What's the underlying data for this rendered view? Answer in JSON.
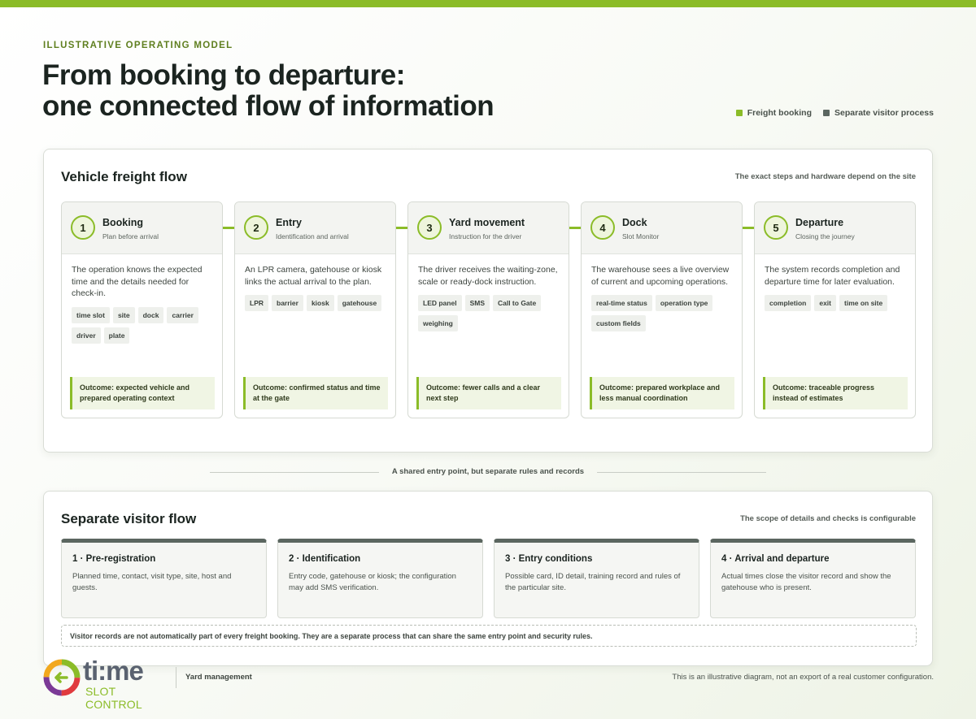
{
  "header": {
    "eyebrow": "ILLUSTRATIVE OPERATING MODEL",
    "title_line1": "From booking to departure:",
    "title_line2": "one connected flow of information"
  },
  "legend": [
    {
      "label": "Freight booking",
      "color": "#8bbc28"
    },
    {
      "label": "Separate visitor process",
      "color": "#5b6660"
    }
  ],
  "freight": {
    "title": "Vehicle freight flow",
    "note": "The exact steps and hardware depend on the site",
    "steps": [
      {
        "num": "1",
        "title": "Booking",
        "subtitle": "Plan before arrival",
        "body": "The operation knows the expected time and the details needed for check-in.",
        "tags": [
          "time slot",
          "site",
          "dock",
          "carrier",
          "driver",
          "plate"
        ],
        "outcome": "Outcome: expected vehicle and prepared operating context"
      },
      {
        "num": "2",
        "title": "Entry",
        "subtitle": "Identification and arrival",
        "body": "An LPR camera, gatehouse or kiosk links the actual arrival to the plan.",
        "tags": [
          "LPR",
          "barrier",
          "kiosk",
          "gatehouse"
        ],
        "outcome": "Outcome: confirmed status and time at the gate"
      },
      {
        "num": "3",
        "title": "Yard movement",
        "subtitle": "Instruction for the driver",
        "body": "The driver receives the waiting-zone, scale or ready-dock instruction.",
        "tags": [
          "LED panel",
          "SMS",
          "Call to Gate",
          "weighing"
        ],
        "outcome": "Outcome: fewer calls and a clear next step"
      },
      {
        "num": "4",
        "title": "Dock",
        "subtitle": "Slot Monitor",
        "body": "The warehouse sees a live overview of current and upcoming operations.",
        "tags": [
          "real-time status",
          "operation type",
          "custom fields"
        ],
        "outcome": "Outcome: prepared workplace and less manual coordination"
      },
      {
        "num": "5",
        "title": "Departure",
        "subtitle": "Closing the journey",
        "body": "The system records completion and departure time for later evaluation.",
        "tags": [
          "completion",
          "exit",
          "time on site"
        ],
        "outcome": "Outcome: traceable progress instead of estimates"
      }
    ]
  },
  "divider": "A shared entry point, but separate rules and records",
  "visitor": {
    "title": "Separate visitor flow",
    "note": "The scope of details and checks is configurable",
    "cards": [
      {
        "title": "1 · Pre-registration",
        "body": "Planned time, contact, visit type, site, host and guests."
      },
      {
        "title": "2 · Identification",
        "body": "Entry code, gatehouse or kiosk; the configuration may add SMS verification."
      },
      {
        "title": "3 · Entry conditions",
        "body": "Possible card, ID detail, training record and rules of the particular site."
      },
      {
        "title": "4 · Arrival and departure",
        "body": "Actual times close the visitor record and show the gatehouse who is present."
      }
    ],
    "footnote": "Visitor records are not automatically part of every freight booking. They are a separate process that can share the same entry point and security rules."
  },
  "footer": {
    "logo_main": "ti:me",
    "logo_sub": "SLOT CONTROL",
    "product": "Yard management",
    "disclaimer": "This is an illustrative diagram, not an export of a real customer configuration."
  }
}
